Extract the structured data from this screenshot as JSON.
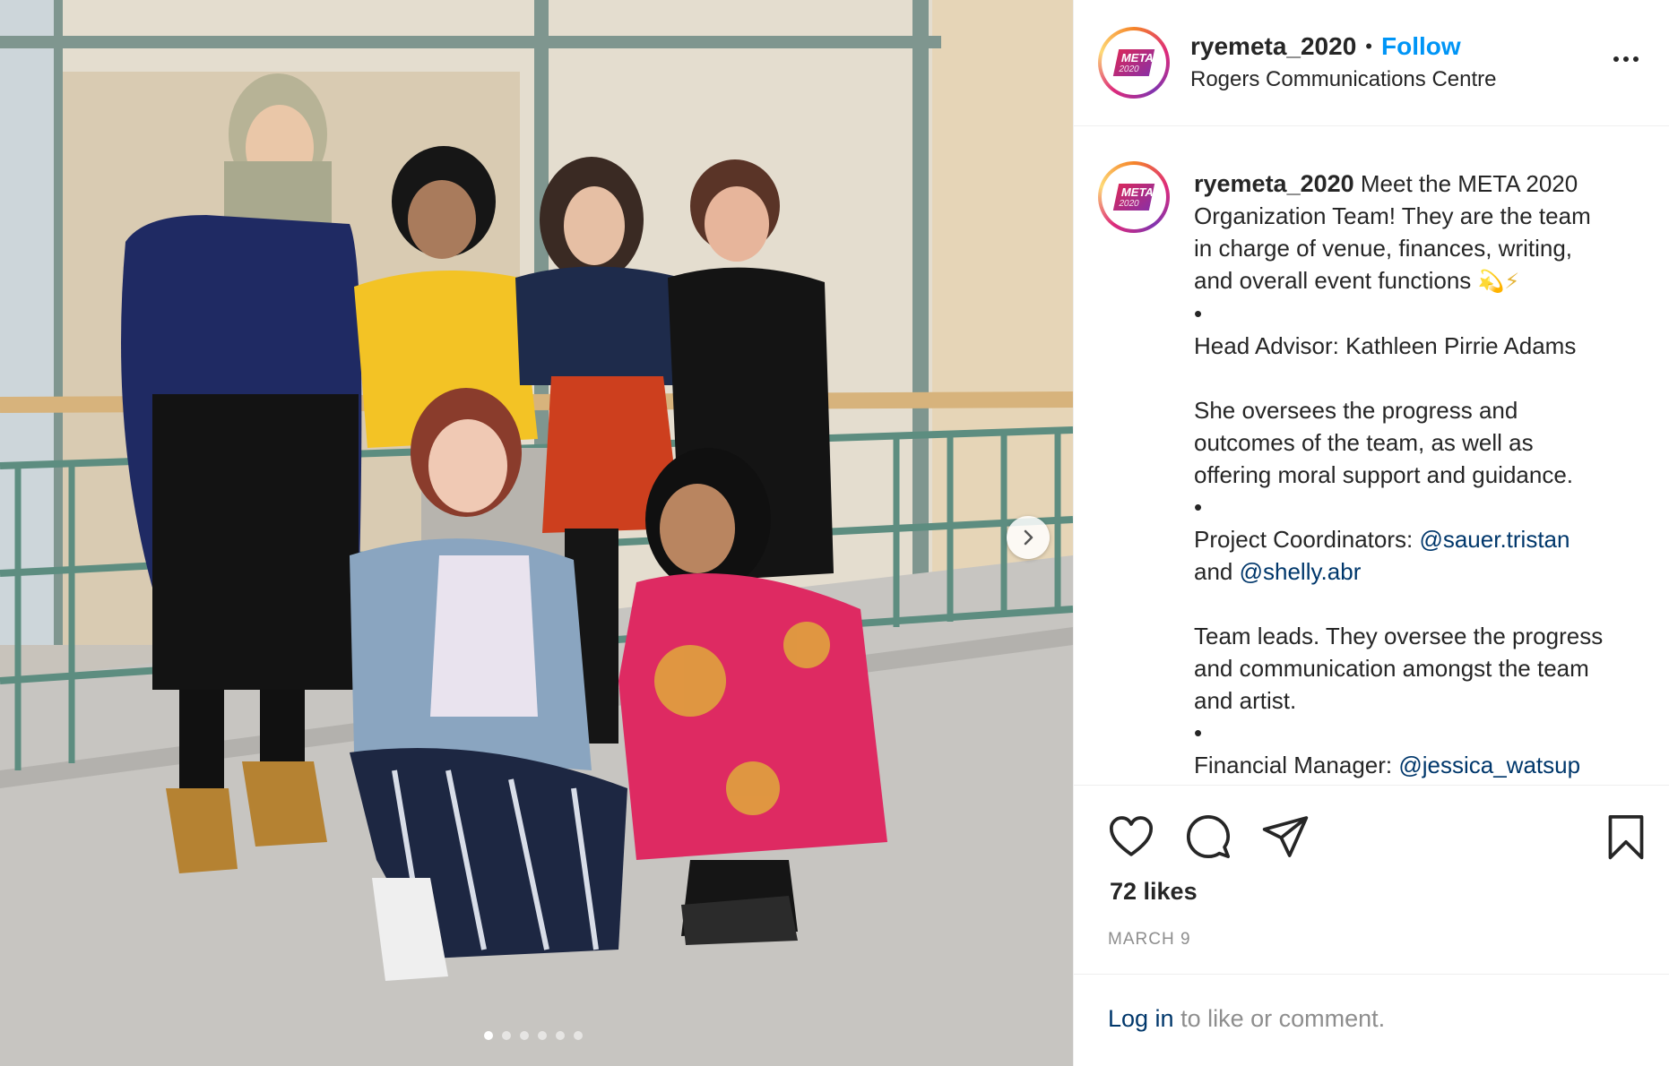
{
  "photo": {
    "carousel_dots": 6,
    "active_dot": 0,
    "next_icon": "chevron-right-icon"
  },
  "header": {
    "avatar_text": "META",
    "avatar_year": "2020",
    "username": "ryemeta_2020",
    "separator": "•",
    "follow_label": "Follow",
    "location": "Rogers Communications Centre",
    "more_icon": "more-options-icon"
  },
  "caption": {
    "username": "ryemeta_2020",
    "line1": " Meet the META 2020\nOrganization Team! They are the team\nin charge of venue, finances, writing,\nand overall event functions ",
    "emoji": "💫⚡",
    "block1": "\n•\nHead Advisor: Kathleen Pirrie Adams\n\nShe oversees the progress and\noutcomes of the team, as well as\noffering moral support and guidance.\n•\nProject Coordinators: ",
    "mention1": "@sauer.tristan",
    "block2": "\nand ",
    "mention2": "@shelly.abr",
    "block3": "\n\nTeam leads. They oversee the progress\nand communication amongst the team\nand artist.\n•\nFinancial Manager: ",
    "mention3": "@jessica_watsup"
  },
  "actions": {
    "like_icon": "heart-icon",
    "comment_icon": "comment-icon",
    "share_icon": "share-icon",
    "save_icon": "bookmark-icon",
    "likes": "72 likes",
    "date": "MARCH 9"
  },
  "footer": {
    "login_label": "Log in",
    "login_suffix": " to like or comment."
  },
  "colors": {
    "follow": "#0095f6",
    "mention": "#00376b",
    "muted": "#8e8e8e",
    "text": "#262626"
  }
}
